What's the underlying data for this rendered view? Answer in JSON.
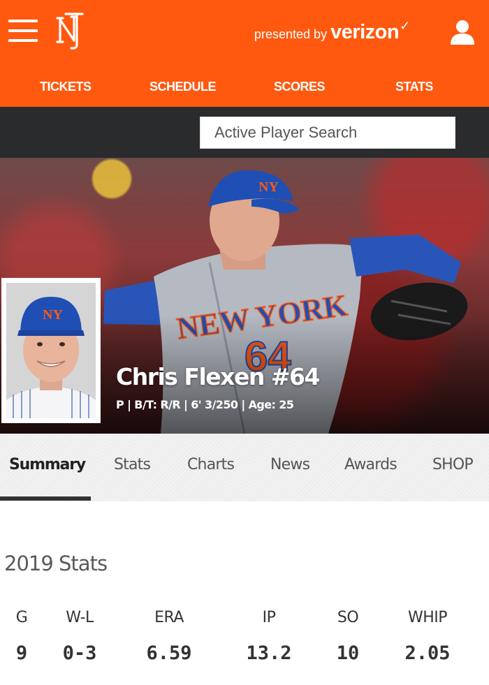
{
  "header": {
    "presented_by": "presented by",
    "sponsor": "verizon",
    "sponsor_mark": "✓",
    "brand_color": "#ff5910",
    "nav": [
      {
        "label": "TICKETS"
      },
      {
        "label": "SCHEDULE"
      },
      {
        "label": "SCORES"
      },
      {
        "label": "STATS"
      }
    ]
  },
  "search": {
    "placeholder": "Active Player Search"
  },
  "player": {
    "name": "Chris Flexen #64",
    "meta": "P | B/T: R/R | 6' 3/250 | Age: 25",
    "jersey_text": "NEW YORK",
    "jersey_number": "64"
  },
  "tabs": [
    {
      "label": "Summary",
      "active": true
    },
    {
      "label": "Stats"
    },
    {
      "label": "Charts"
    },
    {
      "label": "News"
    },
    {
      "label": "Awards"
    },
    {
      "label": "SHOP"
    }
  ],
  "stats": {
    "title": "2019 Stats",
    "columns": [
      {
        "header": "G",
        "value": "9"
      },
      {
        "header": "W-L",
        "value": "0-3"
      },
      {
        "header": "ERA",
        "value": "6.59"
      },
      {
        "header": "IP",
        "value": "13.2"
      },
      {
        "header": "SO",
        "value": "10"
      },
      {
        "header": "WHIP",
        "value": "2.05"
      }
    ]
  },
  "icons": [
    "menu-icon",
    "mets-logo-icon",
    "user-icon"
  ]
}
